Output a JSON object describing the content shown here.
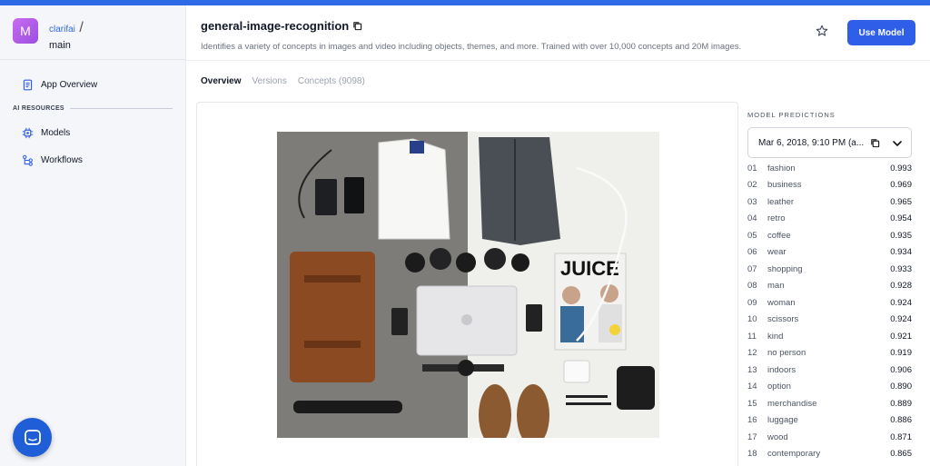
{
  "sidebar": {
    "avatar_letter": "M",
    "org": "clarifai",
    "org_separator": "/",
    "app_name": "main",
    "app_overview": "App Overview",
    "section_label": "AI RESOURCES",
    "items": [
      "Models",
      "Workflows"
    ]
  },
  "header": {
    "title": "general-image-recognition",
    "description": "Identifies a variety of concepts in images and video including objects, themes, and more. Trained with over 10,000 concepts and 20M images.",
    "use_model_label": "Use Model"
  },
  "tabs": [
    {
      "label": "Overview",
      "active": true
    },
    {
      "label": "Versions",
      "active": false
    },
    {
      "label": "Concepts (9098)",
      "active": false
    }
  ],
  "predictions": {
    "title": "MODEL PREDICTIONS",
    "version": "Mar 6, 2018, 9:10 PM (a...",
    "rows": [
      {
        "idx": "01",
        "name": "fashion",
        "value": "0.993"
      },
      {
        "idx": "02",
        "name": "business",
        "value": "0.969"
      },
      {
        "idx": "03",
        "name": "leather",
        "value": "0.965"
      },
      {
        "idx": "04",
        "name": "retro",
        "value": "0.954"
      },
      {
        "idx": "05",
        "name": "coffee",
        "value": "0.935"
      },
      {
        "idx": "06",
        "name": "wear",
        "value": "0.934"
      },
      {
        "idx": "07",
        "name": "shopping",
        "value": "0.933"
      },
      {
        "idx": "08",
        "name": "man",
        "value": "0.928"
      },
      {
        "idx": "09",
        "name": "woman",
        "value": "0.924"
      },
      {
        "idx": "10",
        "name": "scissors",
        "value": "0.924"
      },
      {
        "idx": "11",
        "name": "kind",
        "value": "0.921"
      },
      {
        "idx": "12",
        "name": "no person",
        "value": "0.919"
      },
      {
        "idx": "13",
        "name": "indoors",
        "value": "0.906"
      },
      {
        "idx": "14",
        "name": "option",
        "value": "0.890"
      },
      {
        "idx": "15",
        "name": "merchandise",
        "value": "0.889"
      },
      {
        "idx": "16",
        "name": "luggage",
        "value": "0.886"
      },
      {
        "idx": "17",
        "name": "wood",
        "value": "0.871"
      },
      {
        "idx": "18",
        "name": "contemporary",
        "value": "0.865"
      }
    ]
  },
  "photo": {
    "magazine_title": "JUICE"
  },
  "colors": {
    "accent": "#2f5fe8",
    "avatar": "#b95ee8"
  },
  "icons": {
    "app_overview": "document-icon",
    "models": "chip-icon",
    "workflows": "workflow-icon",
    "copy": "copy-icon",
    "star": "star-icon",
    "chevron": "chevron-down-icon",
    "chat": "chat-icon"
  }
}
